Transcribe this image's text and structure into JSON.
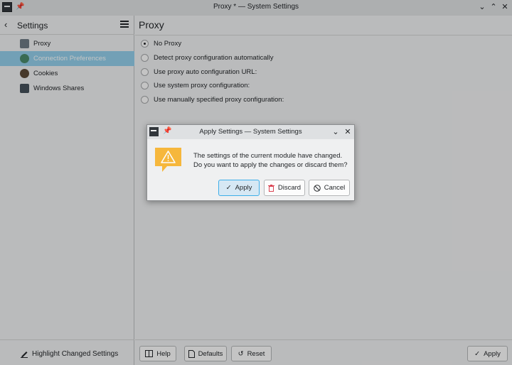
{
  "window": {
    "title": "Proxy * — System Settings",
    "controls": [
      "chevron-down",
      "chevron-up",
      "close"
    ]
  },
  "sidebar": {
    "title": "Settings",
    "items": [
      {
        "label": "Proxy",
        "icon": "proxy-icon"
      },
      {
        "label": "Connection Preferences",
        "icon": "connection-icon",
        "active": true
      },
      {
        "label": "Cookies",
        "icon": "cookie-icon"
      },
      {
        "label": "Windows Shares",
        "icon": "windows-shares-icon"
      }
    ],
    "highlight_label": "Highlight Changed Settings"
  },
  "content": {
    "title": "Proxy",
    "options": [
      {
        "label": "No Proxy",
        "checked": true
      },
      {
        "label": "Detect proxy configuration automatically",
        "checked": false
      },
      {
        "label": "Use proxy auto configuration URL:",
        "checked": false
      },
      {
        "label": "Use system proxy configuration:",
        "checked": false
      },
      {
        "label": "Use manually specified proxy configuration:",
        "checked": false
      }
    ],
    "footer": {
      "help_label": "Help",
      "defaults_label": "Defaults",
      "reset_label": "Reset",
      "apply_label": "Apply"
    }
  },
  "dialog": {
    "title": "Apply Settings — System Settings",
    "message_line1": "The settings of the current module have changed.",
    "message_line2": "Do you want to apply the changes or discard them?",
    "apply_label": "Apply",
    "discard_label": "Discard",
    "cancel_label": "Cancel"
  },
  "colors": {
    "accent": "#3daee9",
    "selection": "#93cee9",
    "warning": "#f6b73c",
    "discard_red": "#da4453"
  }
}
